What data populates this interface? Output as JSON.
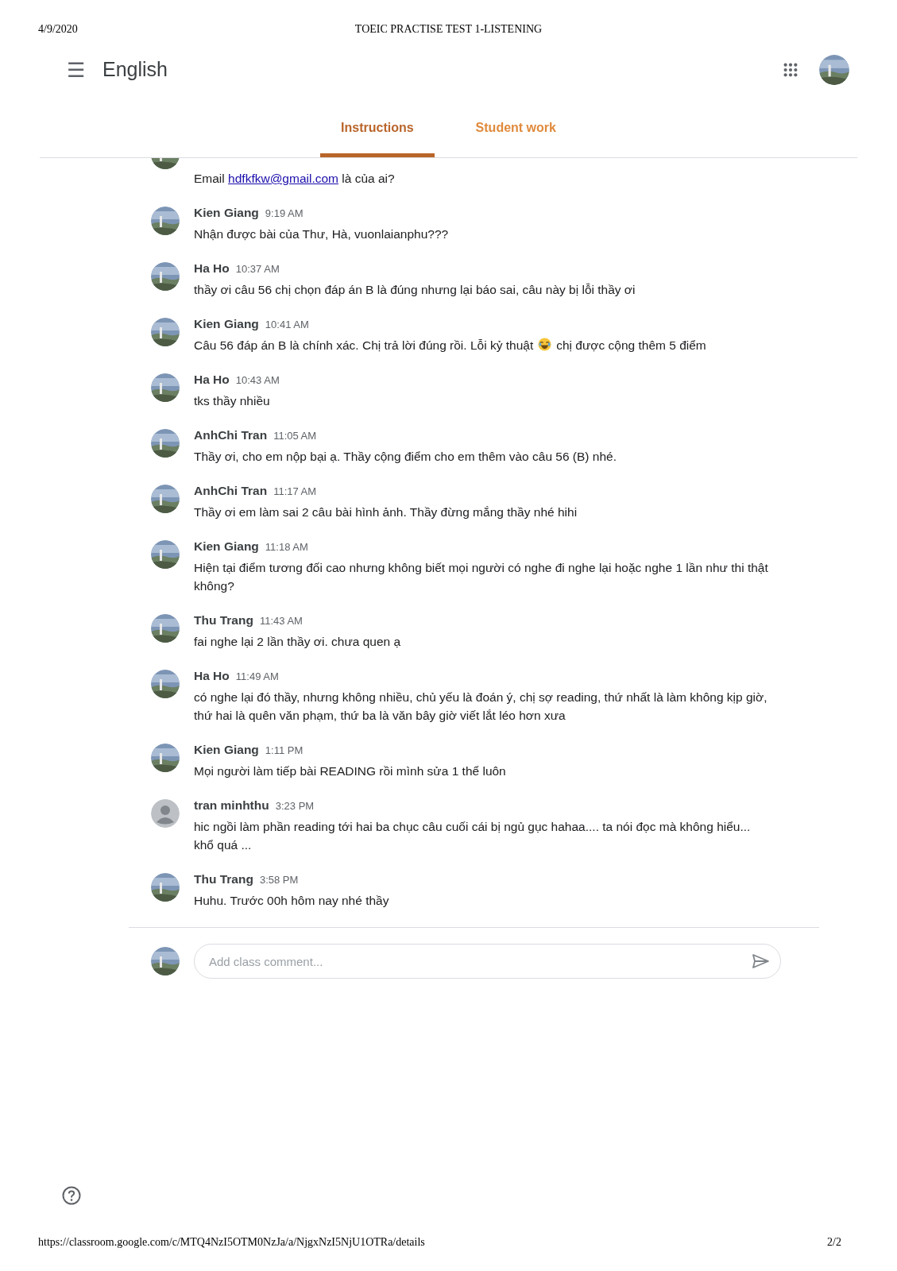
{
  "print_header": {
    "date": "4/9/2020",
    "title": "TOEIC PRACTISE TEST 1-LISTENING"
  },
  "app_bar": {
    "menu_icon": "☰",
    "title": "English"
  },
  "tabs": [
    {
      "label": "Instructions",
      "selected": true
    },
    {
      "label": "Student work",
      "selected": false
    }
  ],
  "comments": [
    {
      "body": [
        {
          "kind": "text",
          "text": "Email "
        },
        {
          "kind": "link",
          "text": "hdfkfkw@gmail.com"
        },
        {
          "kind": "text",
          "text": " là của ai?"
        }
      ]
    },
    {
      "author": "Kien Giang",
      "time": "9:19 AM",
      "body": [
        {
          "kind": "text",
          "text": "Nhận được bài của Thư, Hà, vuonlaianphu???"
        }
      ]
    },
    {
      "author": "Ha Ho",
      "time": "10:37 AM",
      "body": [
        {
          "kind": "text",
          "text": "thầy ơi câu 56 chị chọn đáp án B là đúng nhưng lại báo sai, câu này bị lỗi thầy ơi"
        }
      ]
    },
    {
      "author": "Kien Giang",
      "time": "10:41 AM",
      "body": [
        {
          "kind": "text",
          "text": "Câu 56 đáp án B là chính xác. Chị trả lời đúng rồi. Lỗi kỷ thuật"
        },
        {
          "kind": "emoji"
        },
        {
          "kind": "text",
          "text": "chị được cộng thêm 5 điểm"
        }
      ]
    },
    {
      "author": "Ha Ho",
      "time": "10:43 AM",
      "body": [
        {
          "kind": "text",
          "text": "tks thầy nhiều"
        }
      ]
    },
    {
      "author": "AnhChi Tran",
      "time": "11:05 AM",
      "body": [
        {
          "kind": "text",
          "text": "Thầy ơi, cho em nộp bại ạ. Thầy cộng điểm cho em thêm vào câu 56 (B) nhé."
        }
      ]
    },
    {
      "author": "AnhChi Tran",
      "time": "11:17 AM",
      "body": [
        {
          "kind": "text",
          "text": "Thầy ơi em làm sai 2 câu bài hình ảnh. Thầy đừng mắng thầy nhé hihi"
        }
      ]
    },
    {
      "author": "Kien Giang",
      "time": "11:18 AM",
      "body": [
        {
          "kind": "text",
          "text": "Hiện tại điểm tương đối cao nhưng không biết mọi người có nghe đi nghe lại hoặc nghe 1 lần như thi thật không?"
        }
      ]
    },
    {
      "author": "Thu Trang",
      "time": "11:43 AM",
      "body": [
        {
          "kind": "text",
          "text": "fai nghe lại 2 lần thầy ơi. chưa quen ạ"
        }
      ]
    },
    {
      "author": "Ha Ho",
      "time": "11:49 AM",
      "body": [
        {
          "kind": "text",
          "text": "có nghe lại đó thầy, nhưng không nhiều, chủ yếu là đoán ý, chị sợ reading, thứ nhất là làm không kịp giờ, thứ hai là quên văn phạm, thứ ba là văn bây giờ viết lắt léo hơn xưa"
        }
      ]
    },
    {
      "author": "Kien Giang",
      "time": "1:11 PM",
      "body": [
        {
          "kind": "text",
          "text": "Mọi người làm tiếp bài READING rồi mình sửa 1 thể luôn"
        }
      ]
    },
    {
      "author": "tran minhthu",
      "time": "3:23 PM",
      "kind": "default",
      "body": [
        {
          "kind": "text",
          "text": "hic ngồi làm phần reading tới hai ba chục câu cuối cái bị ngủ gục hahaa.... ta nói đọc mà không hiểu... khổ quá ..."
        }
      ]
    },
    {
      "author": "Thu Trang",
      "time": "3:58 PM",
      "body": [
        {
          "kind": "text",
          "text": "Huhu. Trước 00h hôm nay nhé thầy"
        }
      ]
    }
  ],
  "comment_input": {
    "placeholder": "Add class comment..."
  },
  "print_footer": {
    "url": "https://classroom.google.com/c/MTQ4NzI5OTM0NzJa/a/NjgxNzI5NjU1OTRa/details",
    "page": "2/2"
  }
}
